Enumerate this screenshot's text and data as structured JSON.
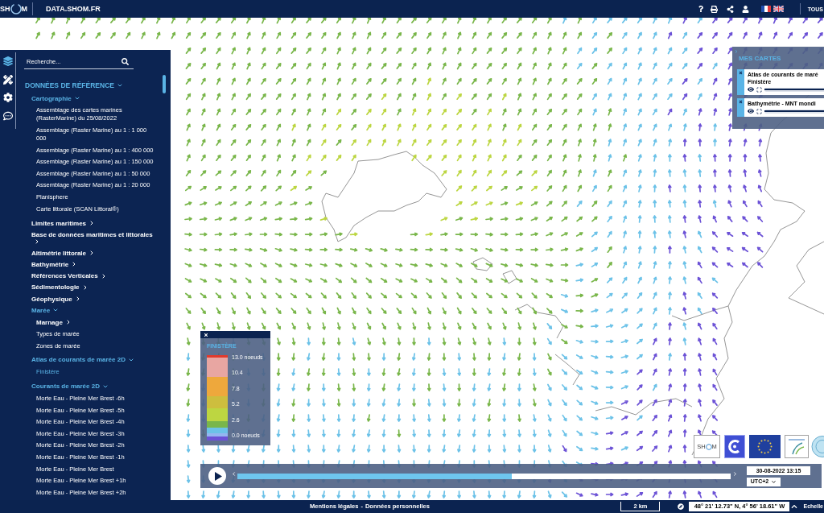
{
  "header": {
    "logo": {
      "text_start": "SH",
      "text_end": "M"
    },
    "site_title": "DATA.SHOM.FR",
    "site_menu": "TOUS"
  },
  "sidebar": {
    "tool_rail": [
      {
        "selected": true
      },
      {
        "selected": false
      },
      {
        "selected": false
      },
      {
        "selected": false
      }
    ],
    "search": {
      "placeholder": "Recherche..."
    },
    "tree": [
      {
        "label": "DONNÉES DE RÉFÉRENCE",
        "kind": "group",
        "expanded": true,
        "children": [
          {
            "label": "Cartographie",
            "kind": "group",
            "expanded": true,
            "children": [
              {
                "label": "Assemblage des cartes marines (RasterMarine) du 25/08/2022",
                "kind": "layer",
                "selected": false
              },
              {
                "label": "Assemblage (Raster Marine) au 1 : 1 000 000",
                "kind": "layer",
                "selected": false
              },
              {
                "label": "Assemblage (Raster Marine) au 1 : 400 000",
                "kind": "layer",
                "selected": false
              },
              {
                "label": "Assemblage (Raster Marine) au 1 : 150 000",
                "kind": "layer",
                "selected": false
              },
              {
                "label": "Assemblage (Raster Marine) au 1 : 50 000",
                "kind": "layer",
                "selected": false
              },
              {
                "label": "Assemblage (Raster Marine) au 1 : 20 000",
                "kind": "layer",
                "selected": false
              },
              {
                "label": "Planisphere",
                "kind": "layer",
                "selected": false
              },
              {
                "label": "Carte littorale (SCAN Littoral®)",
                "kind": "layer",
                "selected": false
              }
            ]
          },
          {
            "label": "Limites maritimes",
            "kind": "group",
            "expanded": false
          },
          {
            "label": "Base de données maritimes et littorales",
            "kind": "group",
            "expanded": false
          },
          {
            "label": "Altimétrie littorale",
            "kind": "group",
            "expanded": false
          },
          {
            "label": "Bathymétrie",
            "kind": "group",
            "expanded": false
          },
          {
            "label": "Références Verticales",
            "kind": "group",
            "expanded": false
          },
          {
            "label": "Sédimentologie",
            "kind": "group",
            "expanded": false
          },
          {
            "label": "Géophysique",
            "kind": "group",
            "expanded": false
          },
          {
            "label": "Marée",
            "kind": "group",
            "expanded": true,
            "children": [
              {
                "label": "Marnage",
                "kind": "group",
                "expanded": false
              },
              {
                "label": "Types de marée",
                "kind": "layer",
                "selected": false
              },
              {
                "label": "Zones de marée",
                "kind": "layer",
                "selected": false
              }
            ]
          },
          {
            "label": "Atlas de courants de marée 2D",
            "kind": "group",
            "expanded": true,
            "children": [
              {
                "label": "Finistère",
                "kind": "layer",
                "selected": true
              }
            ]
          },
          {
            "label": "Courants de marée 2D",
            "kind": "group",
            "expanded": true,
            "children": [
              {
                "label": "Morte Eau - Pleine Mer Brest -6h",
                "kind": "layer",
                "selected": false
              },
              {
                "label": "Morte Eau - Pleine Mer Brest -5h",
                "kind": "layer",
                "selected": false
              },
              {
                "label": "Morte Eau - Pleine Mer Brest -4h",
                "kind": "layer",
                "selected": false
              },
              {
                "label": "Morte Eau - Pleine Mer Brest -3h",
                "kind": "layer",
                "selected": false
              },
              {
                "label": "Morte Eau - Pleine Mer Brest -2h",
                "kind": "layer",
                "selected": false
              },
              {
                "label": "Morte Eau - Pleine Mer Brest -1h",
                "kind": "layer",
                "selected": false
              },
              {
                "label": "Morte Eau - Pleine Mer Brest",
                "kind": "layer",
                "selected": false
              },
              {
                "label": "Morte Eau - Pleine Mer Brest +1h",
                "kind": "layer",
                "selected": false
              },
              {
                "label": "Morte Eau - Pleine Mer Brest +2h",
                "kind": "layer",
                "selected": false
              }
            ]
          }
        ]
      }
    ]
  },
  "my_maps": {
    "title": "MES CARTES",
    "layers": [
      {
        "title": "Atlas de courants de maré",
        "subtitle": "Finistère",
        "level": 1
      },
      {
        "title": "Bathymétrie - MNT mondi",
        "level": 1
      }
    ]
  },
  "legend": {
    "title": "FINISTÈRE",
    "bands": [
      {
        "color": "#e23a2c"
      },
      {
        "color": "#e8a6a2"
      },
      {
        "color": "#eea83c"
      },
      {
        "color": "#cdbe3e"
      },
      {
        "color": "#bdd641"
      },
      {
        "color": "#79b64a"
      },
      {
        "color": "#6cc2e8"
      },
      {
        "color": "#94b6f0"
      },
      {
        "color": "#6c52d6"
      }
    ],
    "labels": [
      "13.0 noeuds",
      "10.4",
      "7.8",
      "5.2",
      "2.6",
      "0.0 noeuds"
    ]
  },
  "partner_logos": [
    {
      "kind": "wordmark",
      "text_start": "SH",
      "text_end": "M"
    },
    {
      "kind": "c-mark"
    },
    {
      "kind": "star-flag"
    },
    {
      "kind": "wave-mark"
    },
    {
      "kind": "round-seal"
    }
  ],
  "timeline": {
    "level": 0.556,
    "date": "30-08-2022 13:15",
    "timezone": "UTC+2"
  },
  "footer": {
    "links": [
      "Mentions légales",
      "Données personnelles"
    ],
    "separator": "-",
    "scale": "2 km",
    "coordinates": "48° 21' 12.73\" N, 4° 56' 18.61\" W",
    "scale_menu": "Echelle"
  }
}
